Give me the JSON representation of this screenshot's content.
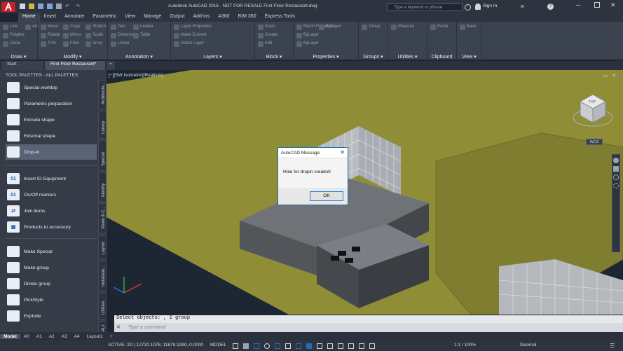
{
  "titlebar": {
    "title": "Autodesk AutoCAD 2016 - NOT FOR RESALE    First Floor Restaurant.dwg",
    "search_placeholder": "Type a keyword or phrase",
    "signin_label": "Sign In",
    "app_icon": "autocad-a-icon"
  },
  "ribbon_tabs": [
    "Home",
    "Insert",
    "Annotate",
    "Parametric",
    "View",
    "Manage",
    "Output",
    "Add-ins",
    "A360",
    "BIM 360",
    "Express Tools"
  ],
  "ribbon": {
    "panels": [
      {
        "title": "Draw ▾",
        "labels": [
          "Line",
          "Polyline",
          "Circle",
          "Arc"
        ]
      },
      {
        "title": "Modify ▾",
        "labels": [
          "Move",
          "Rotate",
          "Trim",
          "Copy",
          "Mirror",
          "Fillet",
          "Stretch",
          "Scale",
          "Array"
        ]
      },
      {
        "title": "Annotation ▾",
        "labels": [
          "Text",
          "Dimension",
          "Linear",
          "Leader",
          "Table"
        ]
      },
      {
        "title": "Layers ▾",
        "labels": [
          "Layer Properties",
          "Make Current",
          "Match Layer"
        ]
      },
      {
        "title": "Block ▾",
        "labels": [
          "Insert",
          "Create",
          "Edit"
        ]
      },
      {
        "title": "Properties ▾",
        "labels": [
          "Match Properties",
          "ByLayer",
          "ByLayer",
          "ByLayer"
        ]
      },
      {
        "title": "Groups ▾",
        "labels": [
          "Group"
        ]
      },
      {
        "title": "Utilities ▾",
        "labels": [
          "Measure"
        ]
      },
      {
        "title": "Clipboard",
        "labels": [
          "Paste"
        ]
      },
      {
        "title": "View ▾",
        "labels": [
          "Base"
        ]
      }
    ],
    "layer_value": "0"
  },
  "doc_tabs": [
    "Start",
    "First Floor Restaurant*"
  ],
  "palette": {
    "title": "TOOL PALETTES - ALL PALETTES",
    "group1": [
      {
        "label": "Special worktop",
        "icon": "worktop-icon"
      },
      {
        "label": "Parametric preparation",
        "icon": "parametric-icon"
      },
      {
        "label": "Extrude shape",
        "icon": "extrude-icon"
      },
      {
        "label": "External shape",
        "icon": "external-shape-icon"
      },
      {
        "label": "Drop-in",
        "icon": "drop-in-icon"
      }
    ],
    "group2": [
      {
        "label": "Insert ID Equipment",
        "icon": "id-equipment-icon",
        "glyph": "01"
      },
      {
        "label": "On/Off markers",
        "icon": "markers-icon",
        "glyph": "01"
      },
      {
        "label": "Join items",
        "icon": "join-icon",
        "glyph": "⇄"
      },
      {
        "label": "Products to accessory",
        "icon": "accessory-icon",
        "glyph": "▦"
      }
    ],
    "group3": [
      {
        "label": "Make Special",
        "icon": "make-special-icon"
      },
      {
        "label": "Make group",
        "icon": "make-group-icon"
      },
      {
        "label": "Divide group",
        "icon": "divide-group-icon"
      },
      {
        "label": "PickStyle",
        "icon": "pickstyle-icon"
      },
      {
        "label": "Explode",
        "icon": "explode-icon"
      }
    ],
    "vtabs": [
      "Architecte...",
      "Library",
      "Special",
      "Identify",
      "Views & C...",
      "Layout",
      "Installatio...",
      "Utilities",
      "SP-ALI"
    ]
  },
  "viewport": {
    "label": "[−][SW Isometric][Realistic]",
    "viewcube_face": "TOP",
    "wcs_label": "WCS"
  },
  "dialog": {
    "title": "AutoCAD Message",
    "message": "Hole for dropin created!",
    "ok_label": "OK"
  },
  "command": {
    "history": "Select objects: , 1 group",
    "placeholder": "Type a command"
  },
  "layout_tabs": [
    "Model",
    "A0",
    "A1",
    "A2",
    "A3",
    "A4",
    "Layout1"
  ],
  "statusbar": {
    "coords": "ACTIVE: 2D | 12720.1078, 11879.1990, 0.0000",
    "model_label": "MODEL",
    "scale": "1:1 / 100%",
    "units": "Decimal"
  },
  "colors": {
    "floor": "#8f8d36",
    "accent": "#1f6fb2"
  }
}
